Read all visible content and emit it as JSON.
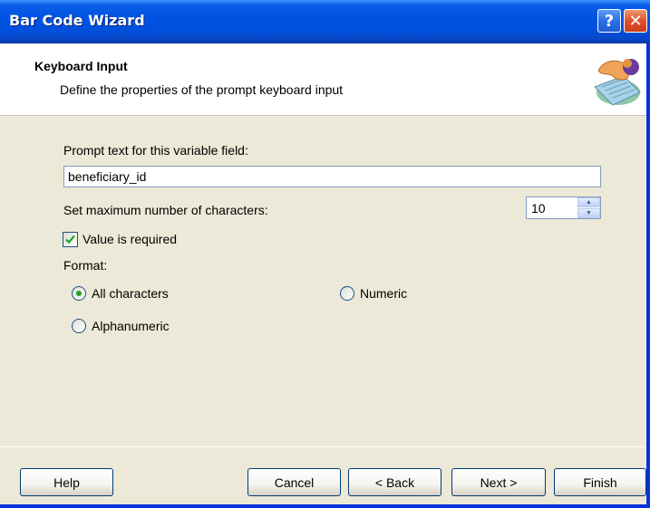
{
  "window": {
    "title": "Bar Code Wizard",
    "help_glyph": "?",
    "close_glyph": "✕"
  },
  "header": {
    "title": "Keyboard Input",
    "subtitle": "Define the properties of the prompt keyboard input"
  },
  "form": {
    "prompt_label": "Prompt text for this variable field:",
    "prompt_value": "beneficiary_id",
    "max_chars_label": "Set maximum number of characters:",
    "max_chars_value": "10",
    "required_label": "Value is required",
    "required_checked": true,
    "format_label": "Format:",
    "format_options": [
      {
        "label": "All characters",
        "selected": true
      },
      {
        "label": "Numeric",
        "selected": false
      },
      {
        "label": "Alphanumeric",
        "selected": false
      }
    ]
  },
  "buttons": {
    "help": "Help",
    "cancel": "Cancel",
    "back": "< Back",
    "next": "Next >",
    "finish": "Finish"
  },
  "colors": {
    "title_bar": "#0054e3",
    "dialog_bg": "#ece9d8",
    "radio_selected": "#21a121",
    "check_mark": "#21a121"
  }
}
